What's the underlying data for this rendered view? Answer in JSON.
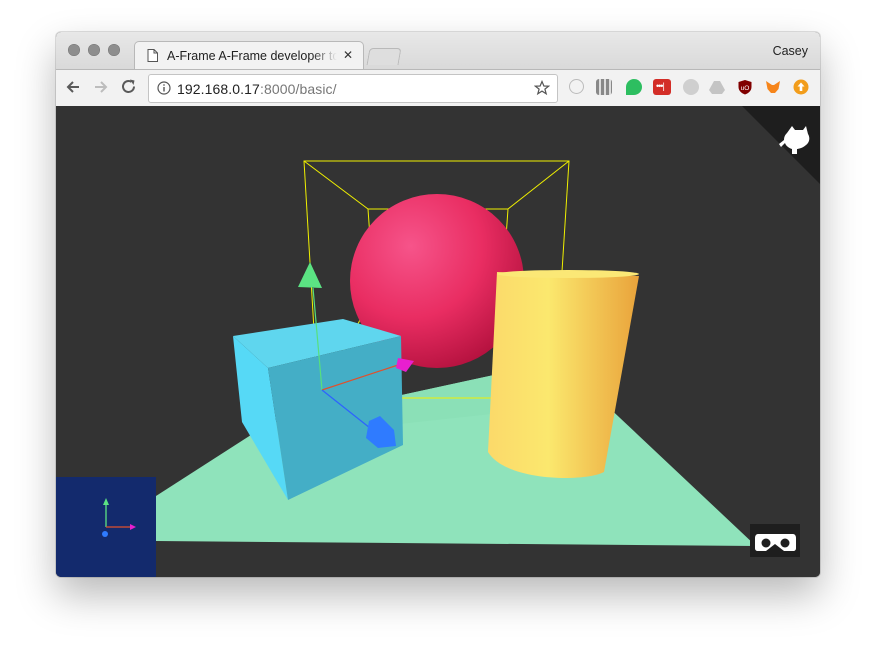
{
  "browser": {
    "tab_title": "A-Frame A-Frame developer tools",
    "tab_close": "✕",
    "user_name": "Casey",
    "url_host": "192.168.0.17",
    "url_rest": ":8000/basic/"
  },
  "icons": {
    "back": "arrow-left-icon",
    "forward": "arrow-right-icon",
    "reload": "reload-icon",
    "info": "info-icon",
    "star": "star-icon",
    "github": "github-octocat-icon",
    "vr": "vr-headset-icon"
  },
  "colors": {
    "scene_bg": "#333333",
    "plane": "#8fe3bb",
    "sphere": "#ef2d5e",
    "cube": "#4cc3d9",
    "cylinder": "#ffc65d",
    "bbox": "#ffff00",
    "axes_panel": "#132a6d"
  }
}
